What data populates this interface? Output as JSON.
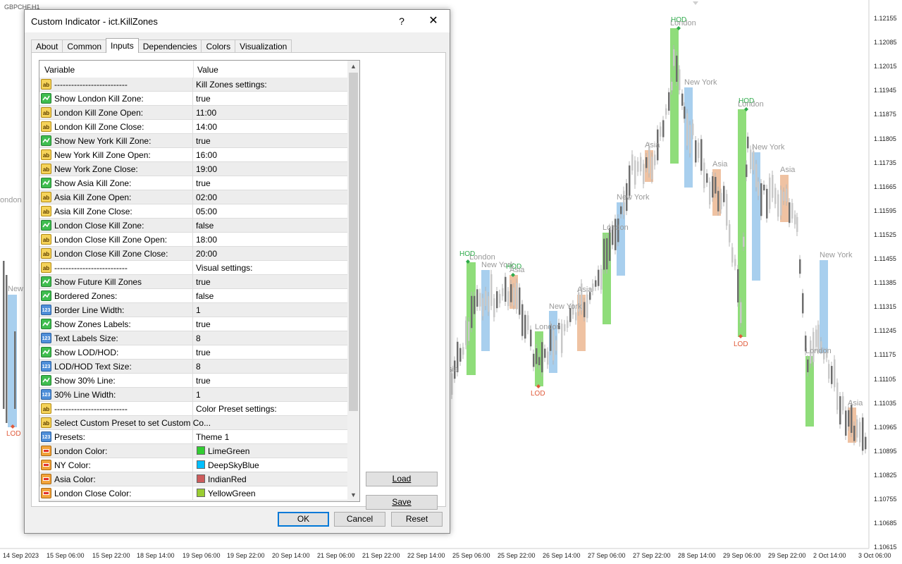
{
  "chart": {
    "symbol": "GBPCHF,H1",
    "price_labels": [
      "1.12155",
      "1.12085",
      "1.12015",
      "1.11945",
      "1.11875",
      "1.11805",
      "1.11735",
      "1.11665",
      "1.11595",
      "1.11525",
      "1.11455",
      "1.11385",
      "1.11315",
      "1.11245",
      "1.11175",
      "1.11105",
      "1.11035",
      "1.10965",
      "1.10895",
      "1.10825",
      "1.10755",
      "1.10685",
      "1.10615"
    ],
    "time_labels": [
      "14 Sep 2023",
      "15 Sep 06:00",
      "15 Sep 22:00",
      "18 Sep 14:00",
      "19 Sep 06:00",
      "19 Sep 22:00",
      "20 Sep 14:00",
      "21 Sep 06:00",
      "21 Sep 22:00",
      "22 Sep 14:00",
      "25 Sep 06:00",
      "25 Sep 22:00",
      "26 Sep 14:00",
      "27 Sep 06:00",
      "27 Sep 22:00",
      "28 Sep 14:00",
      "29 Sep 06:00",
      "29 Sep 22:00",
      "2 Oct 14:00",
      "3 Oct 06:00"
    ],
    "zone_labels": [
      {
        "text": "ondon",
        "kind": "session"
      },
      {
        "text": "New",
        "kind": "session"
      },
      {
        "text": "LOD",
        "kind": "lod"
      },
      {
        "text": "HOD",
        "kind": "hod"
      },
      {
        "text": "London",
        "kind": "session"
      },
      {
        "text": "New York",
        "kind": "session"
      },
      {
        "text": "HOD",
        "kind": "hod"
      },
      {
        "text": "Asia",
        "kind": "session"
      },
      {
        "text": "sia",
        "kind": "session"
      },
      {
        "text": "London",
        "kind": "session"
      },
      {
        "text": "LOD",
        "kind": "lod"
      },
      {
        "text": "New York",
        "kind": "session"
      },
      {
        "text": "Asia",
        "kind": "session"
      },
      {
        "text": "London",
        "kind": "session"
      },
      {
        "text": "New York",
        "kind": "session"
      },
      {
        "text": "Asia",
        "kind": "session"
      },
      {
        "text": "HOD",
        "kind": "hod"
      },
      {
        "text": "London",
        "kind": "session"
      },
      {
        "text": "New York",
        "kind": "session"
      },
      {
        "text": "Asia",
        "kind": "session"
      },
      {
        "text": "HOD",
        "kind": "hod"
      },
      {
        "text": "London",
        "kind": "session"
      },
      {
        "text": "New York",
        "kind": "session"
      },
      {
        "text": "Asia",
        "kind": "session"
      },
      {
        "text": "LOD",
        "kind": "lod"
      },
      {
        "text": "New York",
        "kind": "session"
      },
      {
        "text": "London",
        "kind": "session"
      },
      {
        "text": "Asia",
        "kind": "session"
      }
    ],
    "colors": {
      "london": "#8fdd7a",
      "newyork": "#a8cfee",
      "asia": "#efc2a2",
      "candle": "#6e6e6e",
      "hod": "#2eaa4a",
      "lod": "#e05a3a"
    }
  },
  "dialog": {
    "title": "Custom Indicator - ict.KillZones",
    "help": "?",
    "close": "✕",
    "tabs": [
      "About",
      "Common",
      "Inputs",
      "Dependencies",
      "Colors",
      "Visualization"
    ],
    "active_tab": "Inputs",
    "columns": {
      "variable": "Variable",
      "value": "Value"
    },
    "rows": [
      {
        "icon": "ab",
        "variable": "--------------------------",
        "value": "Kill Zones settings:"
      },
      {
        "icon": "bool",
        "variable": "Show London Kill Zone:",
        "value": "true"
      },
      {
        "icon": "ab",
        "variable": "London Kill Zone Open:",
        "value": "11:00"
      },
      {
        "icon": "ab",
        "variable": "London Kill Zone Close:",
        "value": "14:00"
      },
      {
        "icon": "bool",
        "variable": "Show New York Kill Zone:",
        "value": "true"
      },
      {
        "icon": "ab",
        "variable": "New York Kill Zone Open:",
        "value": "16:00"
      },
      {
        "icon": "ab",
        "variable": "New York Zone Close:",
        "value": "19:00"
      },
      {
        "icon": "bool",
        "variable": "Show Asia Kill Zone:",
        "value": "true"
      },
      {
        "icon": "ab",
        "variable": "Asia Kill Zone Open:",
        "value": "02:00"
      },
      {
        "icon": "ab",
        "variable": "Asia Kill Zone Close:",
        "value": "05:00"
      },
      {
        "icon": "bool",
        "variable": "London Close Kill Zone:",
        "value": "false"
      },
      {
        "icon": "ab",
        "variable": "London Close Kill Zone Open:",
        "value": "18:00"
      },
      {
        "icon": "ab",
        "variable": "London Close Kill Zone Close:",
        "value": "20:00"
      },
      {
        "icon": "ab",
        "variable": "--------------------------",
        "value": "Visual settings:"
      },
      {
        "icon": "bool",
        "variable": "Show Future Kill Zones",
        "value": "true"
      },
      {
        "icon": "bool",
        "variable": "Bordered Zones:",
        "value": "false"
      },
      {
        "icon": "num",
        "variable": "Border Line Width:",
        "value": "1"
      },
      {
        "icon": "bool",
        "variable": "Show Zones Labels:",
        "value": "true"
      },
      {
        "icon": "num",
        "variable": "Text Labels Size:",
        "value": "8"
      },
      {
        "icon": "bool",
        "variable": "Show LOD/HOD:",
        "value": "true"
      },
      {
        "icon": "num",
        "variable": "LOD/HOD Text Size:",
        "value": "8"
      },
      {
        "icon": "bool",
        "variable": "Show 30% Line:",
        "value": "true"
      },
      {
        "icon": "num",
        "variable": "30% Line Width:",
        "value": "1"
      },
      {
        "icon": "ab",
        "variable": "--------------------------",
        "value": "Color Preset settings:"
      },
      {
        "icon": "ab",
        "variable": "Select Custom Preset to set Custom Co...",
        "value": ""
      },
      {
        "icon": "num",
        "variable": "Presets:",
        "value": "Theme 1"
      },
      {
        "icon": "color",
        "variable": "London Color:",
        "value": "LimeGreen",
        "swatch": "#32cd32"
      },
      {
        "icon": "color",
        "variable": "NY Color:",
        "value": "DeepSkyBlue",
        "swatch": "#00bfff"
      },
      {
        "icon": "color",
        "variable": "Asia Color:",
        "value": "IndianRed",
        "swatch": "#cd5c5c"
      },
      {
        "icon": "color",
        "variable": "London Close Color:",
        "value": "YellowGreen",
        "swatch": "#9acd32"
      }
    ],
    "buttons": {
      "load": "Load",
      "save": "Save",
      "ok": "OK",
      "cancel": "Cancel",
      "reset": "Reset"
    }
  }
}
